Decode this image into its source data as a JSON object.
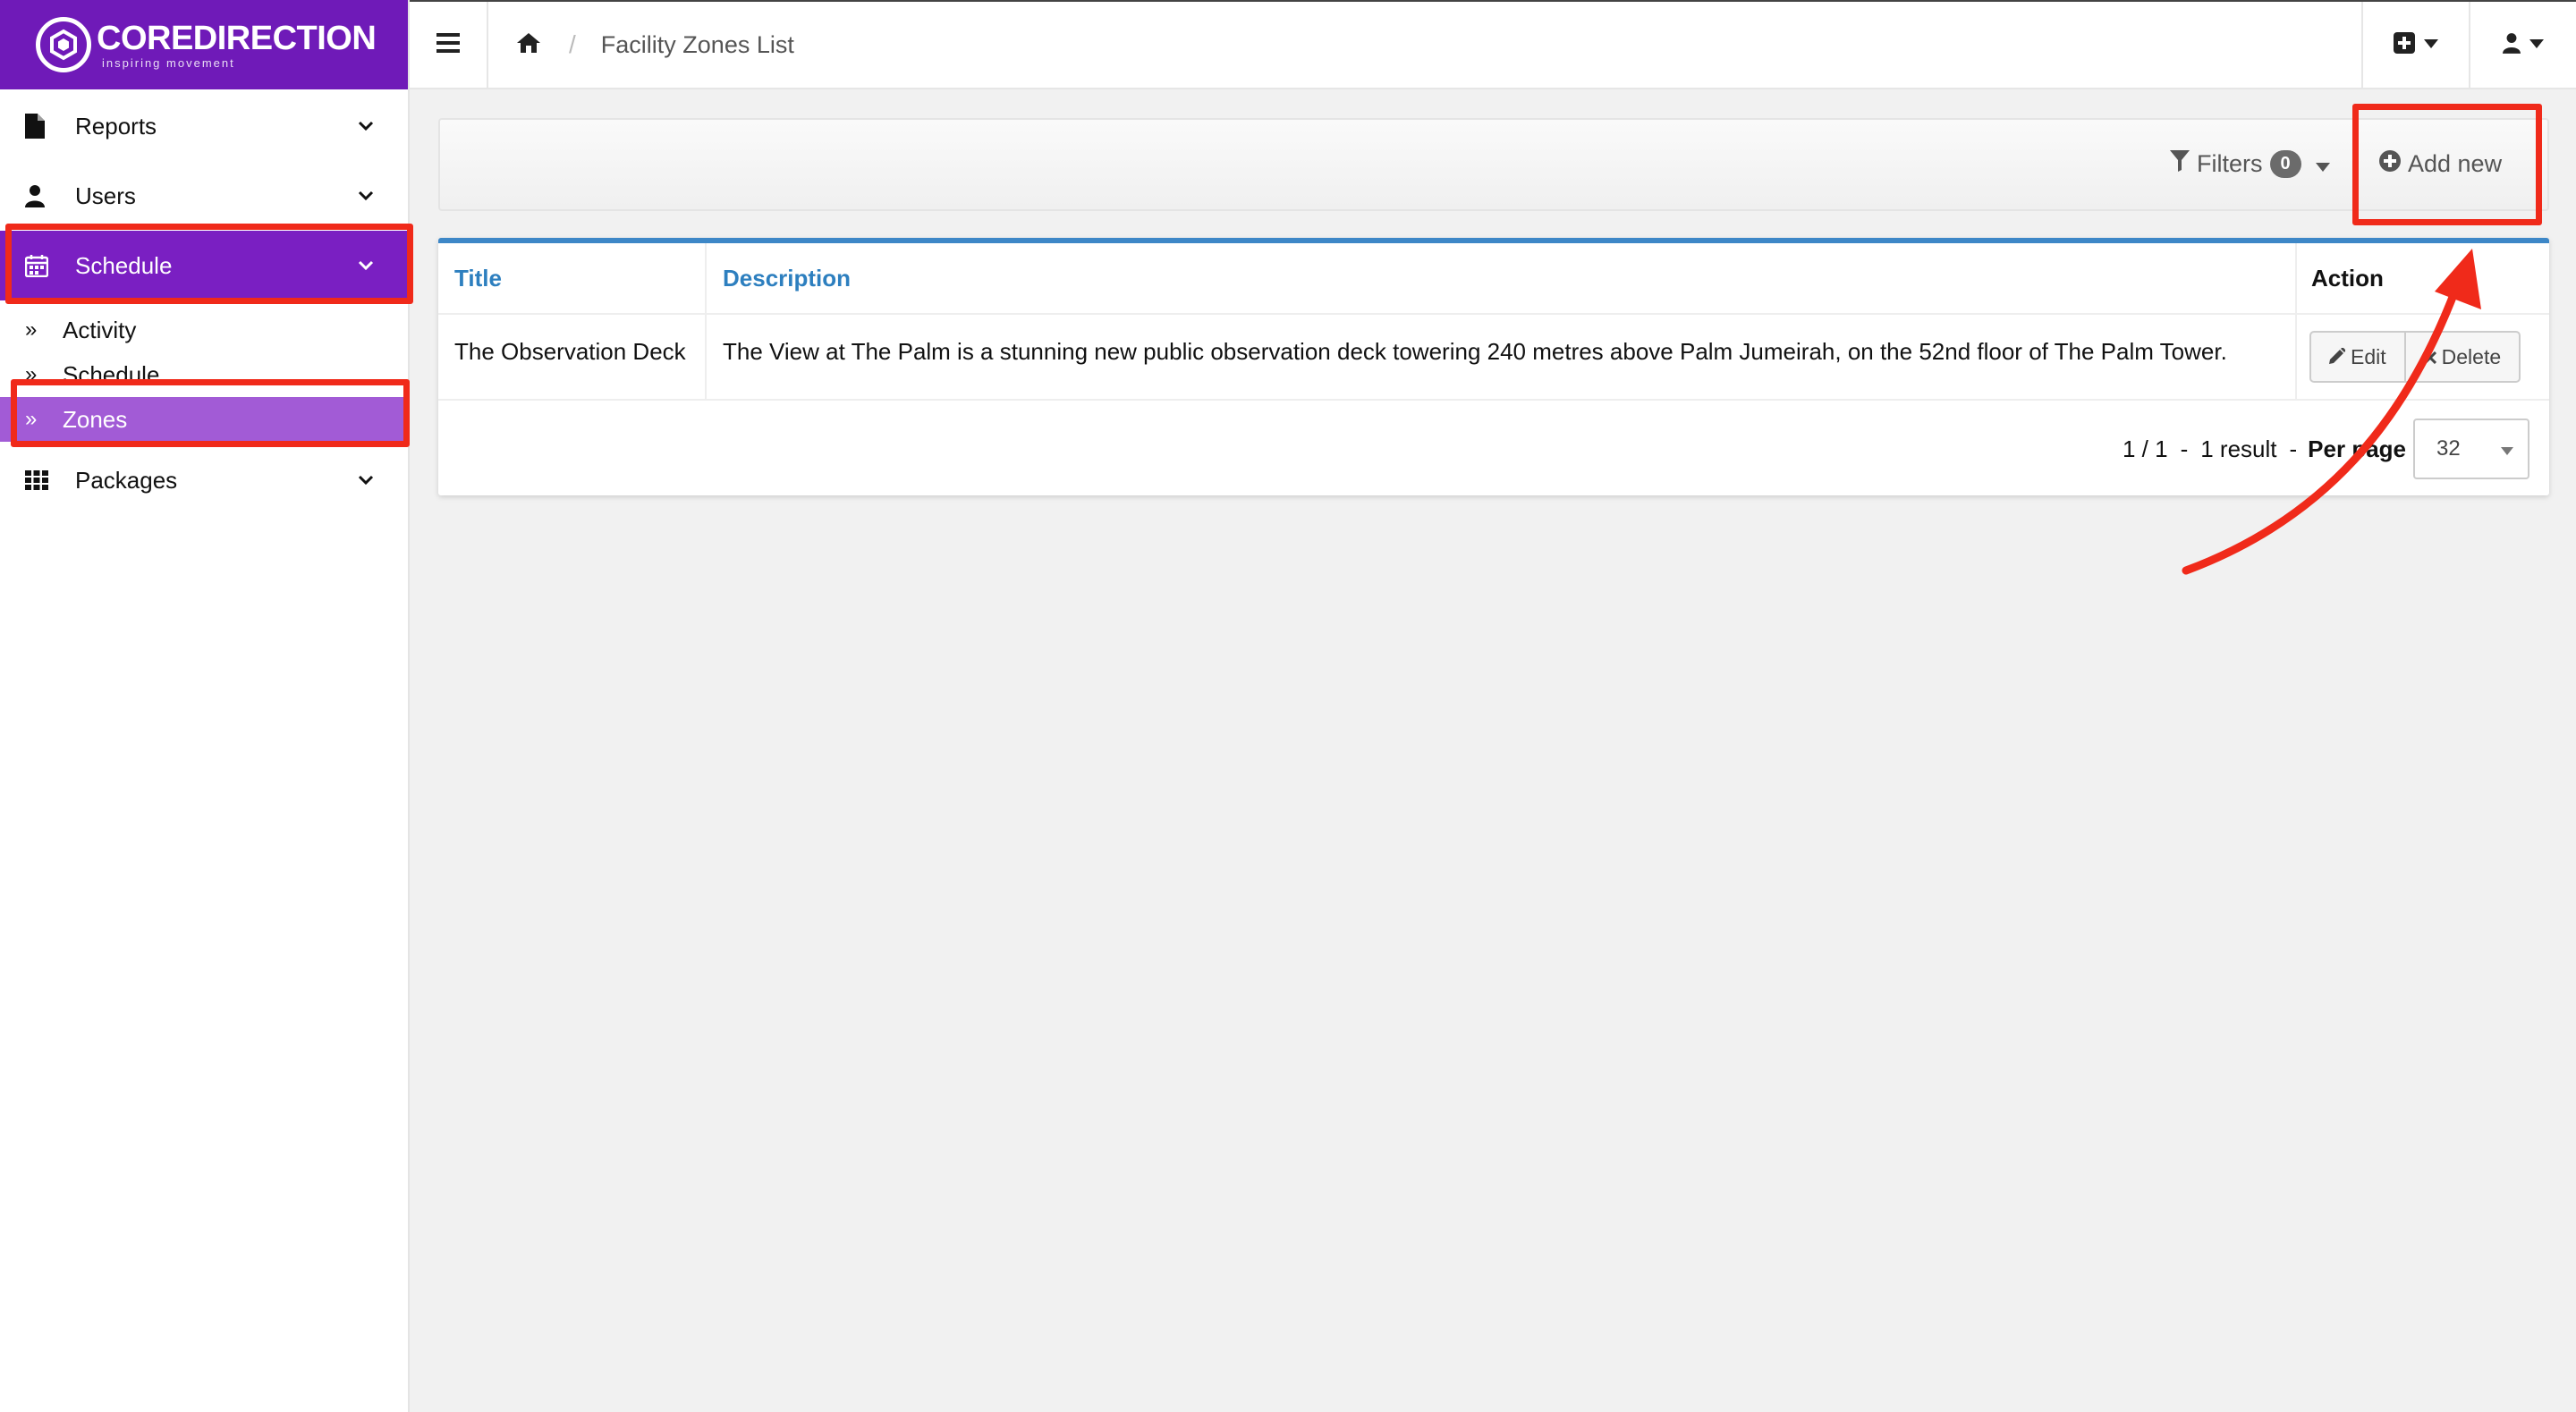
{
  "brand": {
    "name": "COREDIRECTION",
    "tagline": "inspiring movement",
    "color": "#6f1ab8"
  },
  "sidebar": {
    "items": [
      {
        "label": "Reports",
        "icon": "file-icon"
      },
      {
        "label": "Users",
        "icon": "user-icon"
      },
      {
        "label": "Schedule",
        "icon": "calendar-icon",
        "active": true
      },
      {
        "label": "Packages",
        "icon": "grid-icon"
      }
    ],
    "schedule_sub": [
      {
        "label": "Activity"
      },
      {
        "label": "Schedule"
      },
      {
        "label": "Zones",
        "active": true
      }
    ]
  },
  "topbar": {
    "breadcrumb": "Facility Zones List",
    "separator": "/"
  },
  "toolbar": {
    "filters_label": "Filters",
    "filters_count": "0",
    "add_new_label": "Add new"
  },
  "table": {
    "columns": [
      "Title",
      "Description",
      "Action"
    ],
    "rows": [
      {
        "title": "The Observation Deck",
        "description": "The View at The Palm is a stunning new public observation deck towering 240 metres above Palm Jumeirah, on the 52nd floor of The Palm Tower.",
        "edit_label": "Edit",
        "delete_label": "Delete"
      }
    ]
  },
  "pagination": {
    "page": "1 / 1",
    "dash1": "-",
    "results": "1 result",
    "dash2": "-",
    "per_page_label": "Per page",
    "per_page_value": "32"
  },
  "annotation_color": "#f02a1a"
}
